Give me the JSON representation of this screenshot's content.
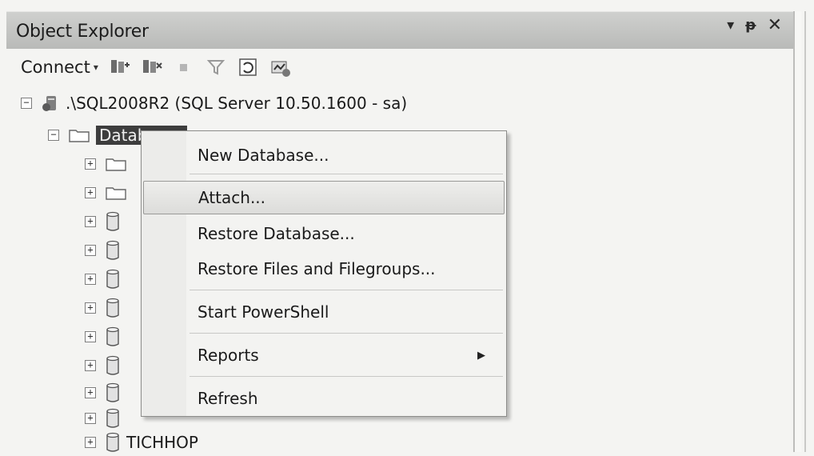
{
  "panel": {
    "title": "Object Explorer",
    "controls": {
      "pin": "↓",
      "autohide": "p",
      "close": "✕"
    }
  },
  "toolbar": {
    "connect_label": "Connect",
    "connect_caret": "▾"
  },
  "tree": {
    "server": {
      "expander": "−",
      "label": ".\\SQL2008R2 (SQL Server 10.50.1600 - sa)"
    },
    "databases": {
      "expander": "−",
      "label": "Databases"
    },
    "children": [
      {
        "expander": "+",
        "icon": "folder-icon",
        "label": ""
      },
      {
        "expander": "+",
        "icon": "folder-icon",
        "label": ""
      },
      {
        "expander": "+",
        "icon": "database-icon",
        "label": ""
      },
      {
        "expander": "+",
        "icon": "database-icon",
        "label": ""
      },
      {
        "expander": "+",
        "icon": "database-icon",
        "label": ""
      },
      {
        "expander": "+",
        "icon": "database-icon",
        "label": ""
      },
      {
        "expander": "+",
        "icon": "database-icon",
        "label": ""
      },
      {
        "expander": "+",
        "icon": "database-icon",
        "label": ""
      },
      {
        "expander": "+",
        "icon": "database-icon",
        "label": ""
      },
      {
        "expander": "+",
        "icon": "database-icon",
        "label": ""
      },
      {
        "expander": "+",
        "icon": "database-icon",
        "label": "TICHHOP"
      }
    ]
  },
  "context_menu": {
    "items": [
      {
        "label": "New Database..."
      },
      {
        "label": "Attach..."
      },
      {
        "label": "Restore Database..."
      },
      {
        "label": "Restore Files and Filegroups..."
      },
      {
        "label": "Start PowerShell"
      },
      {
        "label": "Reports",
        "submenu_arrow": "▶"
      },
      {
        "label": "Refresh"
      }
    ]
  }
}
